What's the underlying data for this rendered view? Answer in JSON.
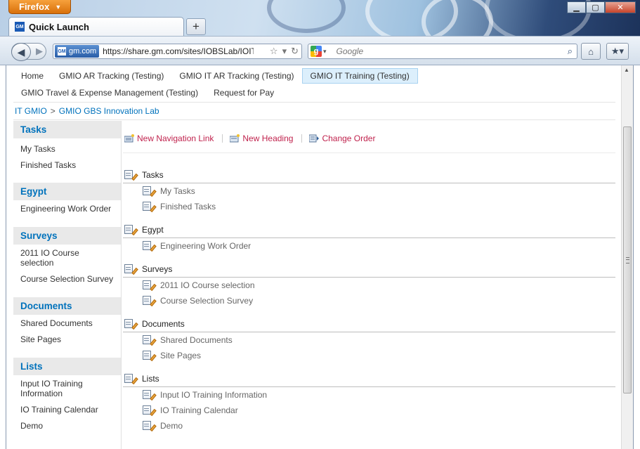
{
  "browser": {
    "menu_button": "Firefox",
    "tab_title": "Quick Launch",
    "identity_label": "gm.com",
    "url": "https://share.gm.com/sites/IOBSLab/IOITTraining",
    "search_placeholder": "Google",
    "gm_logo_text": "GM"
  },
  "topnav": {
    "row1": [
      "Home",
      "GMIO AR Tracking (Testing)",
      "GMIO IT AR Tracking (Testing)",
      "GMIO IT Training (Testing)"
    ],
    "row2": [
      "GMIO Travel & Expense Management (Testing)",
      "Request for Pay"
    ],
    "selected": "GMIO IT Training (Testing)"
  },
  "breadcrumb": {
    "parent": "IT GMIO",
    "separator": ">",
    "current": "GMIO GBS Innovation Lab"
  },
  "quicklaunch": [
    {
      "heading": "Tasks",
      "items": [
        "My Tasks",
        "Finished Tasks"
      ]
    },
    {
      "heading": "Egypt",
      "items": [
        "Engineering Work Order"
      ]
    },
    {
      "heading": "Surveys",
      "items": [
        "2011 IO Course selection",
        "Course Selection Survey"
      ]
    },
    {
      "heading": "Documents",
      "items": [
        "Shared Documents",
        "Site Pages"
      ]
    },
    {
      "heading": "Lists",
      "items": [
        "Input IO Training Information",
        "IO Training Calendar",
        "Demo"
      ]
    }
  ],
  "toolbar": {
    "new_link": "New Navigation Link",
    "new_heading": "New Heading",
    "change_order": "Change Order"
  },
  "colors": {
    "link_blue": "#0072bc",
    "toolbar_link": "#c0224d",
    "selected_tab_bg": "#dceffc"
  }
}
